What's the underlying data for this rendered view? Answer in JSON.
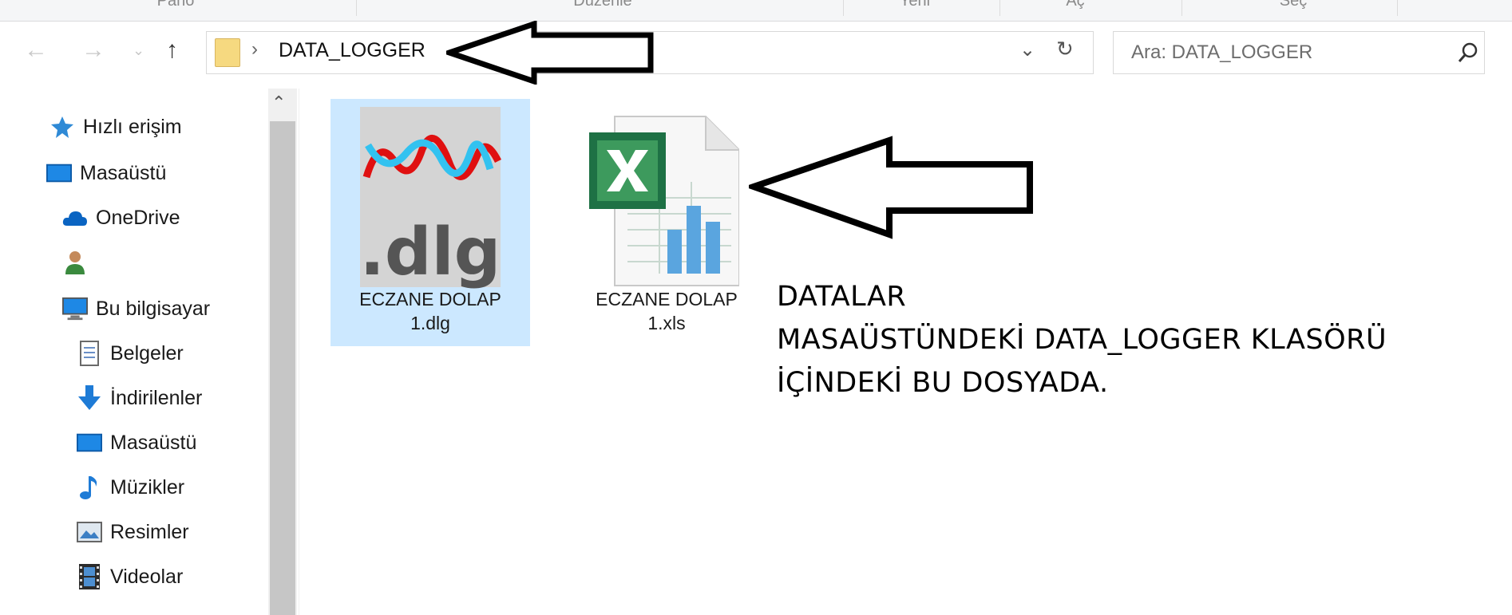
{
  "ribbon": {
    "groups": [
      "Pano",
      "Düzenle",
      "Yeni",
      "Aç",
      "Seç"
    ]
  },
  "navbar": {
    "back_icon": "back-arrow-icon",
    "forward_icon": "forward-arrow-icon",
    "recent_icon": "chevron-down-icon",
    "up_icon": "up-arrow-icon",
    "breadcrumb_separator": "›",
    "path": "DATA_LOGGER",
    "search_placeholder": "Ara: DATA_LOGGER"
  },
  "navpane": {
    "items": [
      {
        "label": "Hızlı erişim",
        "icon": "star-icon"
      },
      {
        "label": "Masaüstü",
        "icon": "desktop-icon"
      },
      {
        "label": "OneDrive",
        "icon": "cloud-icon"
      },
      {
        "label": "",
        "icon": "user-icon"
      },
      {
        "label": "Bu bilgisayar",
        "icon": "computer-icon"
      },
      {
        "label": "Belgeler",
        "icon": "documents-icon"
      },
      {
        "label": "İndirilenler",
        "icon": "download-icon"
      },
      {
        "label": "Masaüstü",
        "icon": "desktop-icon"
      },
      {
        "label": "Müzikler",
        "icon": "music-icon"
      },
      {
        "label": "Resimler",
        "icon": "pictures-icon"
      },
      {
        "label": "Videolar",
        "icon": "videos-icon"
      }
    ]
  },
  "files": [
    {
      "name_line1": "ECZANE DOLAP",
      "name_line2": "1.dlg",
      "icon_text": ".dlg",
      "selected": true
    },
    {
      "name_line1": "ECZANE DOLAP",
      "name_line2": "1.xls",
      "selected": false
    }
  ],
  "annotation": {
    "line1": "DATALAR",
    "line2": "MASAÜSTÜNDEKİ DATA_LOGGER KLASÖRÜ",
    "line3": "İÇİNDEKİ BU DOSYADA."
  },
  "colors": {
    "selection": "#cce8ff",
    "accent": "#0078d7",
    "excel_green": "#1e7145"
  }
}
